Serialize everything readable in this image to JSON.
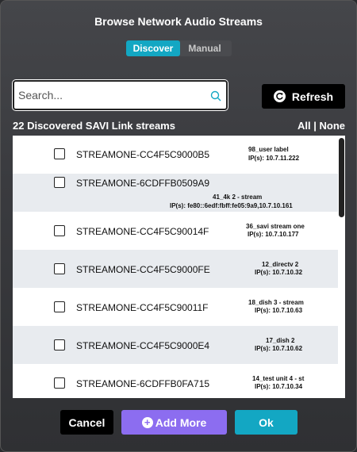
{
  "dialog": {
    "title": "Browse Network Audio Streams",
    "tabs": [
      "Discover",
      "Manual"
    ],
    "search_placeholder": "Search...",
    "refresh_label": "Refresh",
    "count_label": "22 Discovered SAVI Link streams",
    "all_label": "All",
    "separator": "|",
    "none_label": "None"
  },
  "streams": [
    {
      "name": "STREAMONE-CC4F5C9000B5",
      "label": "98_user label",
      "ip": "IP(s): 10.7.11.222"
    },
    {
      "name": "STREAMONE-6CDFFB0509A9",
      "label": "41_4k 2 - stream",
      "ip": "IP(s): fe80::6edf:fbff:fe05:9a9,10.7.10.161"
    },
    {
      "name": "STREAMONE-CC4F5C90014F",
      "label": "36_savi stream one",
      "ip": "IP(s): 10.7.10.177"
    },
    {
      "name": "STREAMONE-CC4F5C9000FE",
      "label": "12_directv 2",
      "ip": "IP(s): 10.7.10.32"
    },
    {
      "name": "STREAMONE-CC4F5C90011F",
      "label": "18_dish 3 - stream",
      "ip": "IP(s): 10.7.10.63"
    },
    {
      "name": "STREAMONE-CC4F5C9000E4",
      "label": "17_dish 2",
      "ip": "IP(s): 10.7.10.62"
    },
    {
      "name": "STREAMONE-6CDFFB0FA715",
      "label": "14_test unit 4 - st",
      "ip": "IP(s): 10.7.10.34"
    }
  ],
  "footer": {
    "cancel_label": "Cancel",
    "add_label": "Add More",
    "ok_label": "Ok"
  },
  "colors": {
    "accent": "#13a7c3",
    "add_more": "#8c6df0",
    "alt_row": "#e8ebef"
  },
  "icons": {
    "search": "search-icon",
    "refresh": "refresh-icon",
    "add": "plus-circle-icon"
  }
}
